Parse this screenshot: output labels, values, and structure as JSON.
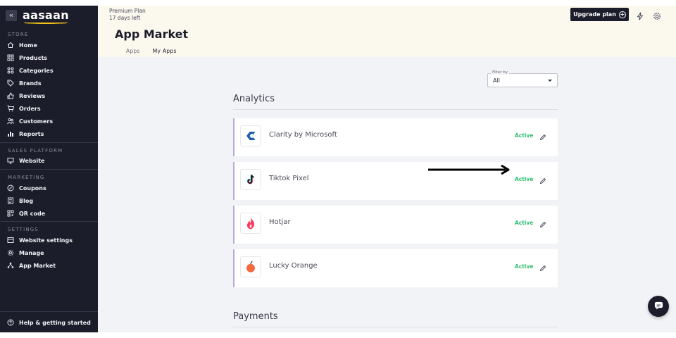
{
  "sidebar": {
    "logo": "aasaan",
    "collapse_icon": "«",
    "sections": {
      "store": "STORE",
      "sales_platform": "SALES PLATFORM",
      "marketing": "MARKETING",
      "settings": "SETTINGS"
    },
    "items": {
      "home": "Home",
      "products": "Products",
      "categories": "Categories",
      "brands": "Brands",
      "reviews": "Reviews",
      "orders": "Orders",
      "customers": "Customers",
      "reports": "Reports",
      "website": "Website",
      "coupons": "Coupons",
      "blog": "Blog",
      "qr_code": "QR code",
      "website_settings": "Website settings",
      "manage": "Manage",
      "app_market": "App Market",
      "help": "Help & getting started"
    }
  },
  "header": {
    "plan_name": "Premium Plan",
    "plan_remaining": "17 days left",
    "title": "App Market",
    "tabs": [
      "Apps",
      "My Apps"
    ],
    "active_tab": "My Apps",
    "upgrade_label": "Upgrade plan",
    "icons": [
      "lightning-icon",
      "gear-icon"
    ]
  },
  "filter": {
    "label": "Filter by",
    "value": "All"
  },
  "sections": {
    "analytics": "Analytics",
    "payments": "Payments"
  },
  "apps": [
    {
      "name": "Clarity by Microsoft",
      "status": "Active",
      "icon": "clarity-icon"
    },
    {
      "name": "Tiktok Pixel",
      "status": "Active",
      "icon": "tiktok-icon"
    },
    {
      "name": "Hotjar",
      "status": "Active",
      "icon": "hotjar-icon"
    },
    {
      "name": "Lucky Orange",
      "status": "Active",
      "icon": "lucky-orange-icon"
    }
  ],
  "colors": {
    "sidebar_bg": "#1c1d2b",
    "header_bg": "#fbf8ee",
    "main_bg": "#f1f3f6",
    "active_status": "#2fbf71",
    "card_accent": "#b6a9d6"
  }
}
